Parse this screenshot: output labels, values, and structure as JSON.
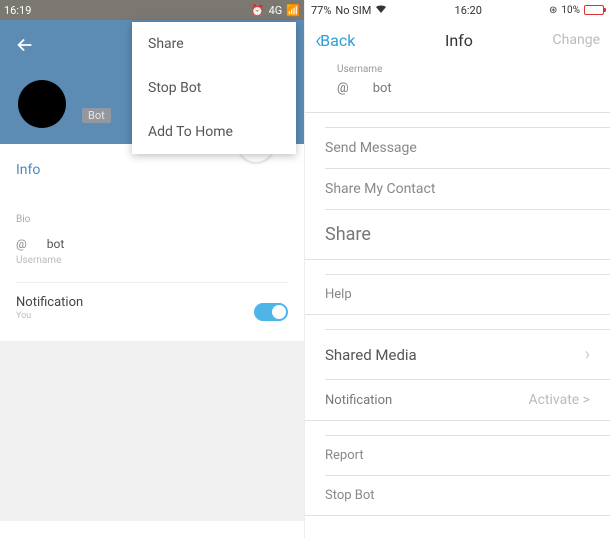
{
  "left": {
    "status": {
      "time": "16:19",
      "network": "4G",
      "signal_icon": "📶",
      "alarm_icon": "⏰"
    },
    "header": {
      "bot_badge": "Bot"
    },
    "dropdown": {
      "share": "Share",
      "stop": "Stop Bot",
      "add_home": "Add To Home"
    },
    "info_label": "Info",
    "bio_label": "Bio",
    "bot_line": {
      "icon": "@",
      "text": "bot"
    },
    "username_label": "Username",
    "notification": {
      "title": "Notification",
      "sub": "You"
    }
  },
  "right": {
    "status": {
      "carrier": "No SIM",
      "pct": "77%",
      "time": "16:20",
      "batt_icon": "⊛",
      "batt_pct": "10%"
    },
    "nav": {
      "back": "Back",
      "title": "Info",
      "change": "Change"
    },
    "username": {
      "label": "Username",
      "icon": "@",
      "value": "bot"
    },
    "actions": {
      "send": "Send Message",
      "share_contact": "Share My Contact",
      "share": "Share",
      "help": "Help",
      "shared_media": "Shared Media",
      "notification": "Notification",
      "activate": "Activate >",
      "report": "Report",
      "stop": "Stop Bot"
    }
  }
}
